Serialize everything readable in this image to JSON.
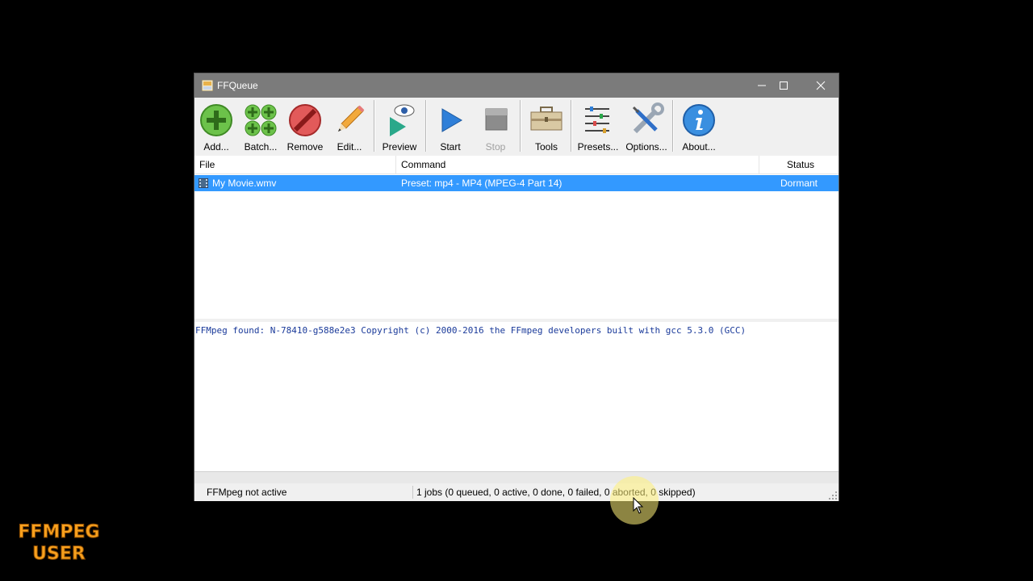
{
  "window": {
    "title": "FFQueue",
    "controls": {
      "minimize": "minimize",
      "maximize": "maximize",
      "close": "close"
    }
  },
  "toolbar": {
    "add": "Add...",
    "batch": "Batch...",
    "remove": "Remove",
    "edit": "Edit...",
    "preview": "Preview",
    "start": "Start",
    "stop": "Stop",
    "tools": "Tools",
    "presets": "Presets...",
    "options": "Options...",
    "about": "About..."
  },
  "queue": {
    "columns": {
      "file": "File",
      "command": "Command",
      "status": "Status"
    },
    "rows": [
      {
        "file": "My Movie.wmv",
        "command": "Preset: mp4 - MP4 (MPEG-4 Part 14)",
        "status": "Dormant",
        "selected": true
      }
    ]
  },
  "log": {
    "line": "FFMpeg found: N-78410-g588e2e3 Copyright (c) 2000-2016 the FFmpeg developers built with gcc 5.3.0 (GCC)"
  },
  "statusbar": {
    "ffmpeg_state": "FFMpeg not active",
    "jobs": "1 jobs (0 queued, 0 active, 0 done, 0 failed, 0 aborted, 0 skipped)"
  },
  "watermark": {
    "line1": "FFMPEG",
    "line2": "USER"
  },
  "colors": {
    "selection": "#3399ff",
    "titlebar": "#7b7b7b",
    "log_text": "#1a3a9a",
    "logo": "#f7a01e"
  }
}
